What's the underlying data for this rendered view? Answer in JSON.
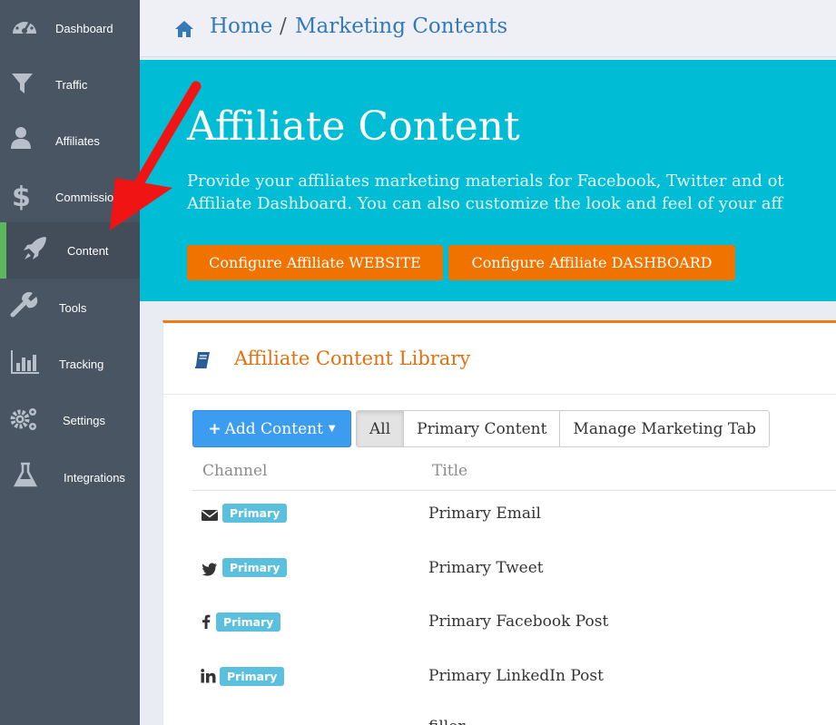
{
  "sidebar": {
    "items": [
      {
        "label": "Dashboard",
        "icon": "dashboard-icon"
      },
      {
        "label": "Traffic",
        "icon": "funnel-icon"
      },
      {
        "label": "Affiliates",
        "icon": "user-icon"
      },
      {
        "label": "Commissio",
        "icon": "dollar-icon"
      },
      {
        "label": "Content",
        "icon": "rocket-icon",
        "active": true
      },
      {
        "label": "Tools",
        "icon": "wrench-icon"
      },
      {
        "label": "Tracking",
        "icon": "bar-chart-icon"
      },
      {
        "label": "Settings",
        "icon": "gears-icon"
      },
      {
        "label": "Integrations",
        "icon": "flask-icon"
      }
    ]
  },
  "breadcrumb": {
    "home": "Home",
    "separator": "/",
    "current": "Marketing Contents"
  },
  "hero": {
    "title": "Affiliate Content",
    "line1": "Provide your affiliates marketing materials for Facebook, Twitter and ot",
    "line2": "Affiliate Dashboard. You can also customize the look and feel of your aff",
    "btn_website": "Configure Affiliate WEBSITE",
    "btn_dashboard": "Configure Affiliate DASHBOARD"
  },
  "library": {
    "title": "Affiliate Content Library",
    "add_button": "Add Content",
    "filters": [
      "All",
      "Primary Content",
      "Manage Marketing Tab"
    ],
    "columns": [
      "Channel",
      "Title"
    ],
    "rows": [
      {
        "channel_icon": "envelope-icon",
        "badge": "Primary",
        "title": "Primary Email"
      },
      {
        "channel_icon": "twitter-icon",
        "badge": "Primary",
        "title": "Primary Tweet"
      },
      {
        "channel_icon": "facebook-icon",
        "badge": "Primary",
        "title": "Primary Facebook Post"
      },
      {
        "channel_icon": "linkedin-icon",
        "badge": "Primary",
        "title": "Primary LinkedIn Post"
      },
      {
        "channel_icon": "",
        "badge": "",
        "title": "filler"
      }
    ]
  },
  "colors": {
    "sidebar": "#4a5563",
    "hero": "#00bcd4",
    "accent_orange": "#f07300",
    "accent_blue": "#3b9cf0",
    "badge": "#5bc0de",
    "active_bar": "#5cb85c",
    "annotation_arrow": "#f01414"
  }
}
